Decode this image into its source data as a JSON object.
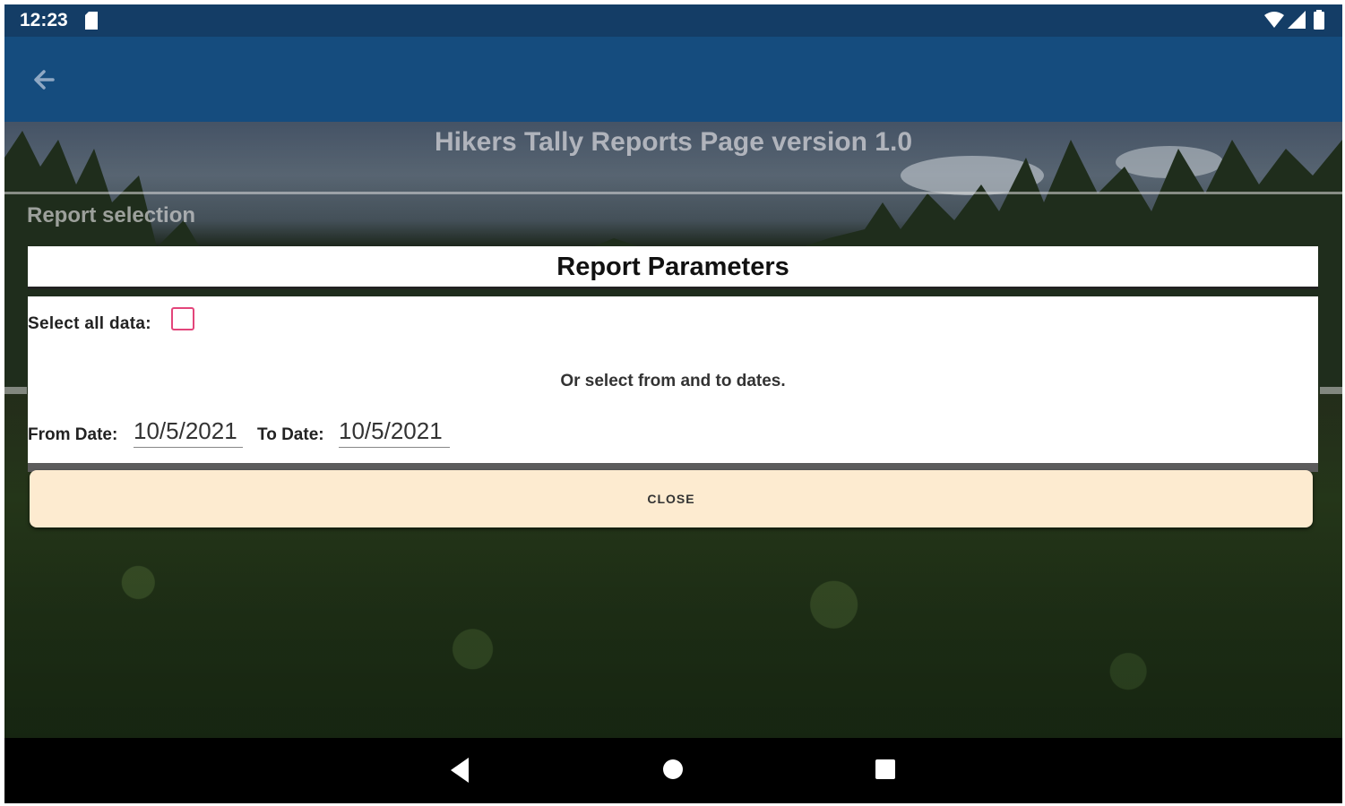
{
  "status_bar": {
    "time": "12:23",
    "icons": [
      "sd-card-icon",
      "wifi-icon",
      "signal-icon",
      "battery-icon"
    ]
  },
  "app_bar": {
    "back_icon": "arrow-left-icon",
    "color": "#154c7e"
  },
  "page": {
    "title": "Hikers Tally Reports Page version 1.0",
    "section_label": "Report selection"
  },
  "dialog": {
    "title": "Report Parameters",
    "select_all_label": "Select all data:",
    "select_all_checked": false,
    "instruction": "Or select from and to dates.",
    "from_date_label": "From Date:",
    "from_date_value": "10/5/2021",
    "to_date_label": "To Date:",
    "to_date_value": "10/5/2021",
    "close_label": "CLOSE",
    "accent_color": "#e3457a"
  },
  "nav_bar": {
    "buttons": [
      "back-triangle-icon",
      "home-circle-icon",
      "recents-square-icon"
    ]
  }
}
